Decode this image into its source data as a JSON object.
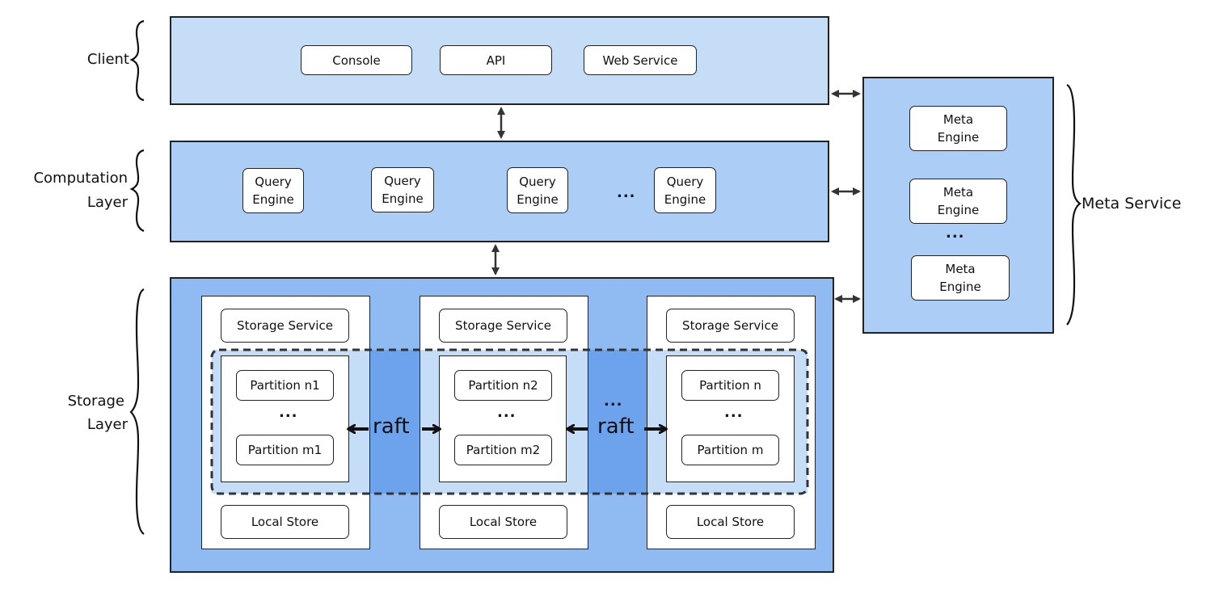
{
  "colors": {
    "client_fill": "#c6ddf8",
    "computation_fill": "#abcdf6",
    "storage_fill": "#8fbaf2",
    "raft_band": "#6da3ec",
    "meta_fill": "#abcdf6",
    "stroke": "#222222"
  },
  "left_labels": {
    "client": "Client",
    "computation_line1": "Computation",
    "computation_line2": "Layer",
    "storage_line1": "Storage",
    "storage_line2": "Layer"
  },
  "client": {
    "items": [
      "Console",
      "API",
      "Web Service"
    ]
  },
  "computation": {
    "engine_line1": "Query",
    "engine_line2": "Engine",
    "ellipsis": "..."
  },
  "storage": {
    "nodes": [
      {
        "service": "Storage Service",
        "partition_first": "Partition n1",
        "partition_last": "Partition m1",
        "ellipsis": "...",
        "local_store": "Local Store"
      },
      {
        "service": "Storage Service",
        "partition_first": "Partition n2",
        "partition_last": "Partition m2",
        "ellipsis": "...",
        "local_store": "Local Store"
      },
      {
        "service": "Storage Service",
        "partition_first": "Partition n",
        "partition_last": "Partition m",
        "ellipsis": "...",
        "local_store": "Local Store"
      }
    ],
    "raft_label": "raft",
    "between_ellipsis": "..."
  },
  "meta": {
    "engine_line1": "Meta",
    "engine_line2": "Engine",
    "ellipsis": "...",
    "service_label": "Meta Service"
  }
}
